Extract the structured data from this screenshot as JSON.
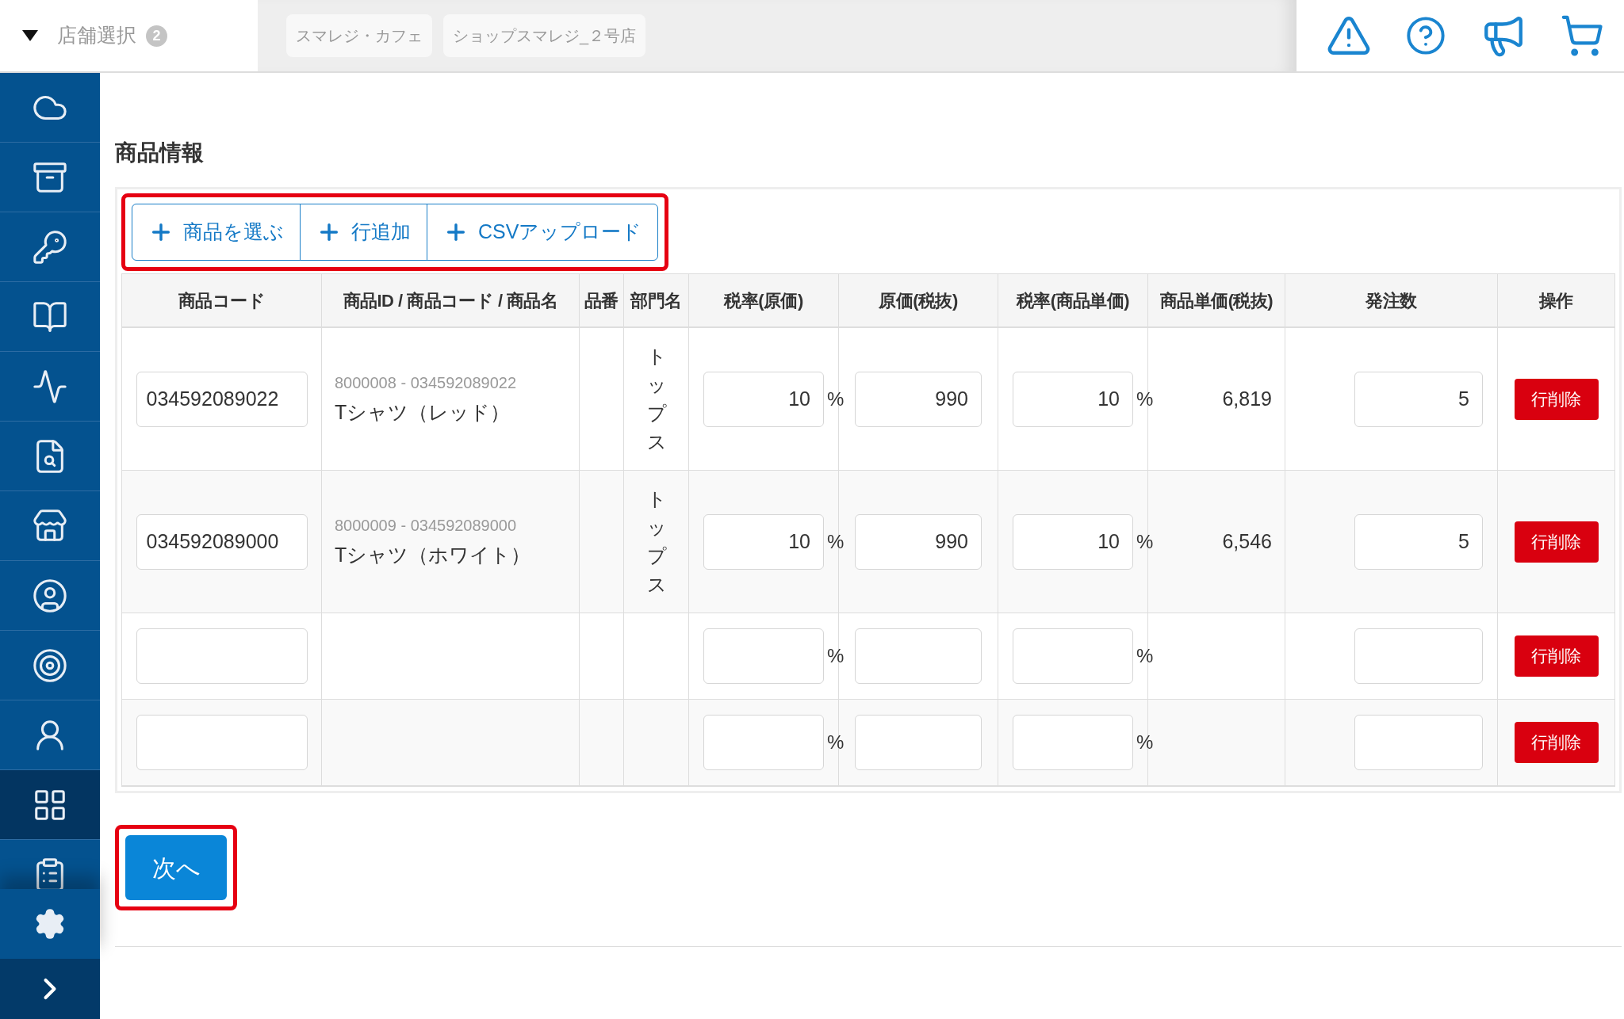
{
  "header": {
    "store_select": {
      "label": "店舗選択",
      "count": "2"
    },
    "stores": [
      "スマレジ・カフェ",
      "ショップスマレジ_２号店"
    ]
  },
  "sidebar": {
    "items": [
      {
        "selected": false
      },
      {
        "selected": false
      },
      {
        "selected": false
      },
      {
        "selected": false
      },
      {
        "selected": false
      },
      {
        "selected": false
      },
      {
        "selected": false
      },
      {
        "selected": false
      },
      {
        "selected": false
      },
      {
        "selected": false
      },
      {
        "selected": true
      },
      {
        "selected": false
      }
    ]
  },
  "page_title": "商品情報",
  "toolbar": {
    "highlighted": true,
    "buttons": [
      "商品を選ぶ",
      "行追加",
      "CSVアップロード"
    ]
  },
  "table": {
    "columns": [
      "商品コード",
      "商品ID / 商品コード / 商品名",
      "品番",
      "部門名",
      "税率(原価)",
      "原価(税抜)",
      "税率(商品単価)",
      "商品単価(税抜)",
      "発注数",
      "操作"
    ],
    "rows": [
      {
        "code": "034592089022",
        "product_id": "8000008 - 034592089022",
        "name": "Tシャツ（レッド）",
        "department": "トップス",
        "cost_tax": "10",
        "cost_tax_unit": "%",
        "cost": "990",
        "price_tax": "10",
        "price_tax_unit": "%",
        "price": "6,819",
        "quantity": "5",
        "action": "行削除"
      },
      {
        "code": "034592089000",
        "product_id": "8000009 - 034592089000",
        "name": "Tシャツ（ホワイト）",
        "department": "トップス",
        "cost_tax": "10",
        "cost_tax_unit": "%",
        "cost": "990",
        "price_tax": "10",
        "price_tax_unit": "%",
        "price": "6,546",
        "quantity": "5",
        "action": "行削除"
      },
      {
        "cost_tax_unit": "%",
        "price_tax_unit": "%",
        "action": "行削除"
      },
      {
        "cost_tax_unit": "%",
        "price_tax_unit": "%",
        "action": "行削除"
      }
    ]
  },
  "next_button": {
    "label": "次へ",
    "highlighted": true
  }
}
